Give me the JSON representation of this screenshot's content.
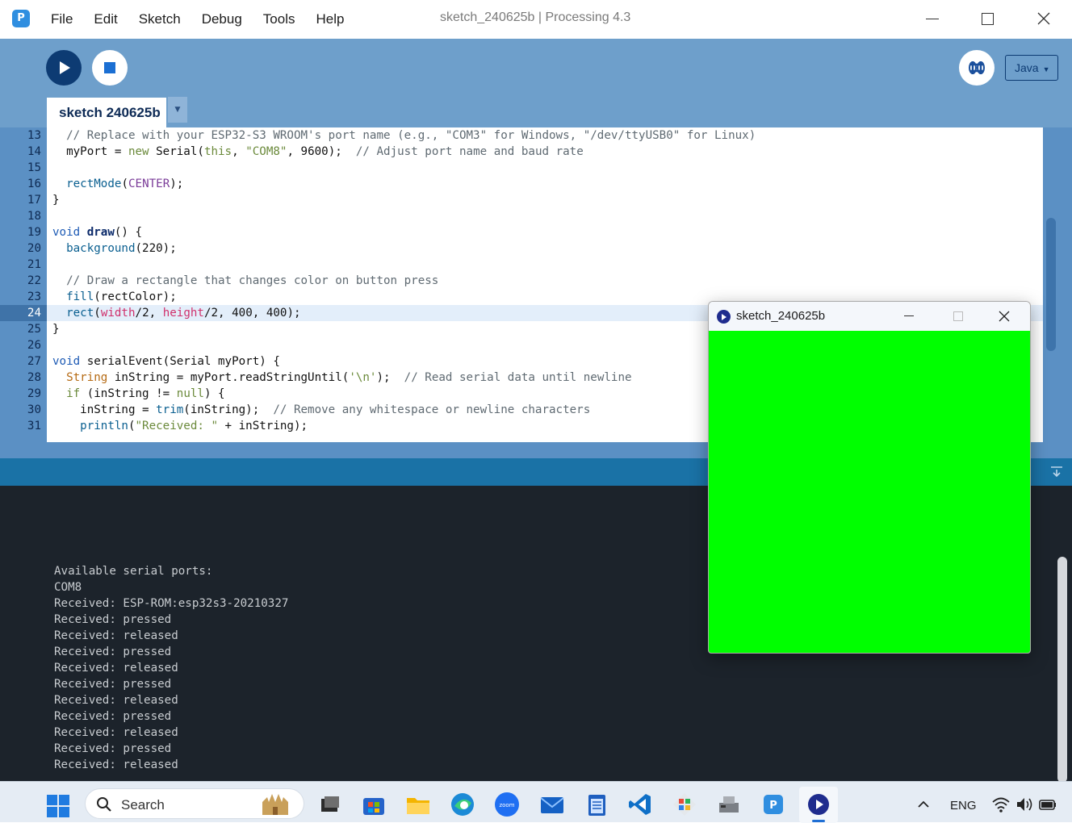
{
  "window": {
    "title": "sketch_240625b | Processing 4.3",
    "menu": [
      "File",
      "Edit",
      "Sketch",
      "Debug",
      "Tools",
      "Help"
    ]
  },
  "toolbar": {
    "run_icon": "play-icon",
    "stop_icon": "stop-icon",
    "debug_icon": "debugger-icon",
    "mode": "Java",
    "sketch_tab": "sketch 240625b"
  },
  "editor": {
    "current_line": "24",
    "lines": [
      {
        "n": "13",
        "code": "  // Replace with your ESP32-S3 WROOM's port name (e.g., \"COM3\" for Windows, \"/dev/ttyUSB0\" for Linux)"
      },
      {
        "n": "14",
        "code": "  myPort = new Serial(this, \"COM8\", 9600);  // Adjust port name and baud rate"
      },
      {
        "n": "15",
        "code": ""
      },
      {
        "n": "16",
        "code": "  rectMode(CENTER);"
      },
      {
        "n": "17",
        "code": "}"
      },
      {
        "n": "18",
        "code": ""
      },
      {
        "n": "19",
        "code": "void draw() {"
      },
      {
        "n": "20",
        "code": "  background(220);"
      },
      {
        "n": "21",
        "code": ""
      },
      {
        "n": "22",
        "code": "  // Draw a rectangle that changes color on button press"
      },
      {
        "n": "23",
        "code": "  fill(rectColor);"
      },
      {
        "n": "24",
        "code": "  rect(width/2, height/2, 400, 400);"
      },
      {
        "n": "25",
        "code": "}"
      },
      {
        "n": "26",
        "code": ""
      },
      {
        "n": "27",
        "code": "void serialEvent(Serial myPort) {"
      },
      {
        "n": "28",
        "code": "  String inString = myPort.readStringUntil('\\n');  // Read serial data until newline"
      },
      {
        "n": "29",
        "code": "  if (inString != null) {"
      },
      {
        "n": "30",
        "code": "    inString = trim(inString);  // Remove any whitespace or newline characters"
      },
      {
        "n": "31",
        "code": "    println(\"Received: \" + inString);"
      }
    ]
  },
  "console": {
    "lines": [
      "Available serial ports:",
      "COM8",
      "Received: ESP-ROM:esp32s3-20210327",
      "Received: pressed",
      "Received: released",
      "Received: pressed",
      "Received: released",
      "Received: pressed",
      "Received: released",
      "Received: pressed",
      "Received: released",
      "Received: pressed",
      "Received: released"
    ]
  },
  "sketch_window": {
    "title": "sketch_240625b",
    "fill_color": "#00ff00"
  },
  "taskbar": {
    "search_label": "Search",
    "language": "ENG",
    "apps": [
      "task-view-icon",
      "store-icon",
      "file-explorer-icon",
      "edge-icon",
      "zoom-icon",
      "mail-icon",
      "notepad-icon",
      "vscode-icon",
      "git-icon",
      "device-icon",
      "processing-icon",
      "processing-sketch-icon"
    ]
  },
  "colors": {
    "accent": "#6e9fcb",
    "gutter": "#5b90c4",
    "console_bg": "#1c232b",
    "run_button": "#0d3b73"
  }
}
